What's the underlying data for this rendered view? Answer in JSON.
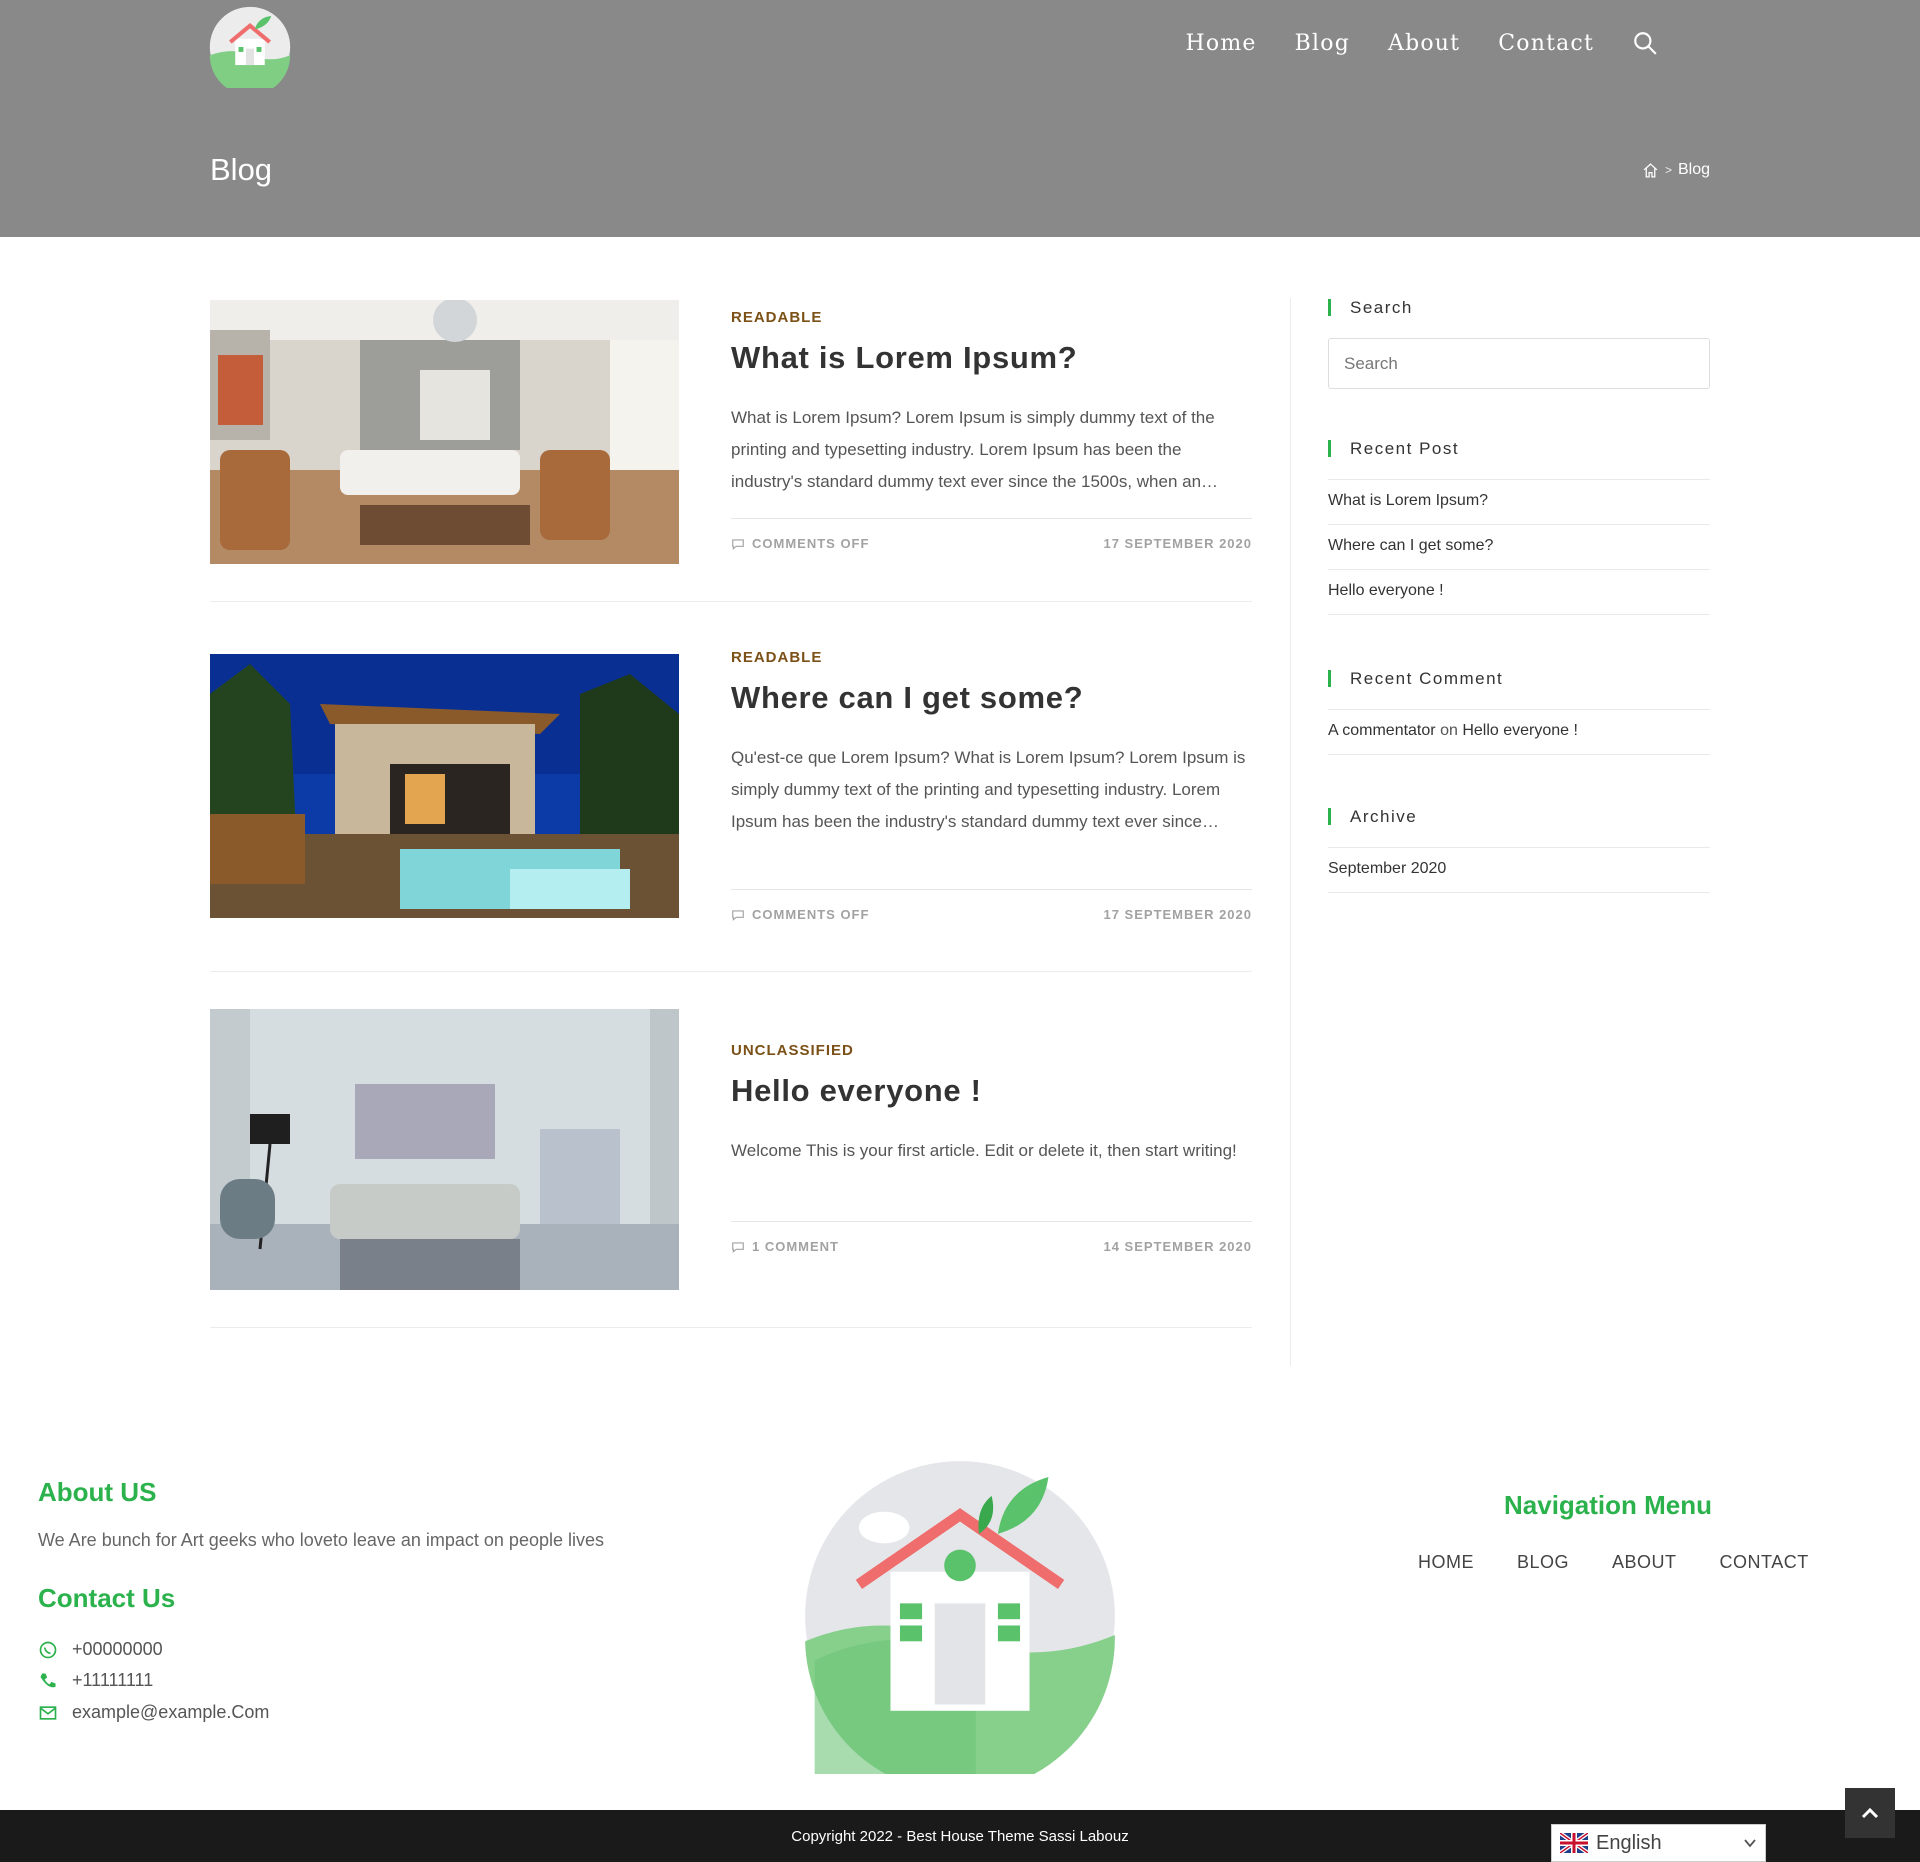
{
  "header": {
    "nav": [
      "Home",
      "Blog",
      "About",
      "Contact"
    ],
    "page_title": "Blog",
    "breadcrumb_current": "Blog",
    "breadcrumb_sep": ">"
  },
  "articles": [
    {
      "category": "READABLE",
      "title": "What is Lorem Ipsum?",
      "excerpt": "What is Lorem Ipsum? Lorem Ipsum is simply dummy text of the printing and typesetting industry. Lorem Ipsum has been the industry's standard dummy text ever since the 1500s, when an…",
      "comments": "COMMENTS OFF",
      "date": "17 SEPTEMBER 2020"
    },
    {
      "category": "READABLE",
      "title": "Where can I get some?",
      "excerpt": "Qu'est-ce que Lorem Ipsum? What is Lorem Ipsum? Lorem Ipsum is simply dummy text of the printing and typesetting industry. Lorem Ipsum has been the industry's standard dummy text ever since…",
      "comments": "COMMENTS OFF",
      "date": "17 SEPTEMBER 2020"
    },
    {
      "category": "UNCLASSIFIED",
      "title": "Hello everyone !",
      "excerpt": "Welcome This is your first article. Edit or delete it, then start writing!",
      "comments": "1 COMMENT",
      "date": "14 SEPTEMBER 2020"
    }
  ],
  "sidebar": {
    "search_title": "Search",
    "search_placeholder": "Search",
    "recent_post_title": "Recent Post",
    "recent_posts": [
      "What is Lorem Ipsum?",
      "Where can I get some?",
      "Hello everyone !"
    ],
    "recent_comment_title": "Recent Comment",
    "comment_author": "A commentator",
    "comment_on": "on",
    "comment_post": "Hello everyone !",
    "archive_title": "Archive",
    "archives": [
      "September 2020"
    ]
  },
  "footer": {
    "about_title": "About US",
    "about_text": "We Are bunch for Art geeks who loveto leave an impact on people lives",
    "contact_title": "Contact Us",
    "whatsapp": "+00000000",
    "phone": "+11111111",
    "email": "example@example.Com",
    "nav_title": "Navigation Menu",
    "nav": [
      "HOME",
      "BLOG",
      "ABOUT",
      "CONTACT"
    ],
    "copyright": "Copyright 2022 - Best House Theme Sassi Labouz",
    "language": "English"
  },
  "colors": {
    "accent": "#2bb24c",
    "category": "#7b5117",
    "header_bg": "#898989",
    "footer_bg": "#1a1a1a"
  }
}
